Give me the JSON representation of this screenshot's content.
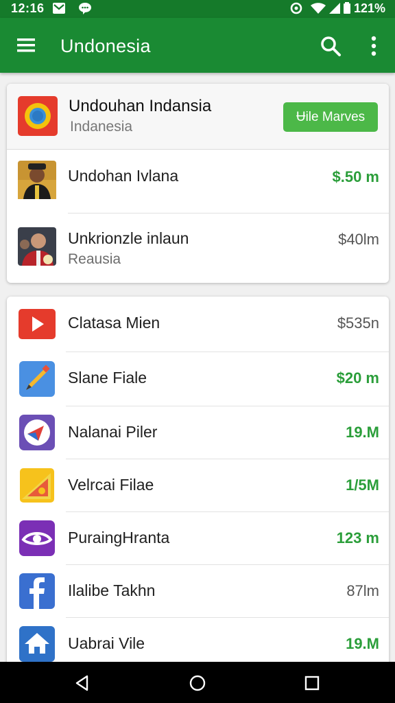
{
  "status": {
    "time": "12:16",
    "battery": "121%"
  },
  "appbar": {
    "title": "Undonesia"
  },
  "top_card": {
    "header": {
      "title": "Undouhan Indansia",
      "subtitle": "Indanesia",
      "button_label": "Ʉile Marves"
    },
    "rows": [
      {
        "name": "Undohan Ivlana",
        "subtitle": "",
        "size": "$.50 m",
        "size_style": "green"
      },
      {
        "name": "Unkrionzle inlaun",
        "subtitle": "Reausia",
        "size": "$40lm",
        "size_style": "grey"
      }
    ]
  },
  "list": [
    {
      "name": "Clatasa Mien",
      "size": "$535n",
      "size_style": "grey",
      "icon": "video-play-icon"
    },
    {
      "name": "Slane Fiale",
      "size": "$20 m",
      "size_style": "green",
      "icon": "pencil-app-icon"
    },
    {
      "name": "Nalanai Piler",
      "size": "19.M",
      "size_style": "green",
      "icon": "compass-icon"
    },
    {
      "name": "Velrcai Filae",
      "size": "1/5M",
      "size_style": "green",
      "icon": "slides-icon"
    },
    {
      "name": "PuraingHranta",
      "size": "123 m",
      "size_style": "green",
      "icon": "eye-icon"
    },
    {
      "name": "Ilalibe Takhn",
      "size": "87lm",
      "size_style": "grey",
      "icon": "facebook-icon"
    },
    {
      "name": "Uabrai Vile",
      "size": "19.M",
      "size_style": "green",
      "icon": "home-icon"
    }
  ],
  "colors": {
    "appbar": "#1a8a33",
    "accent_green": "#2b9e3a",
    "button_green": "#4cb848"
  }
}
